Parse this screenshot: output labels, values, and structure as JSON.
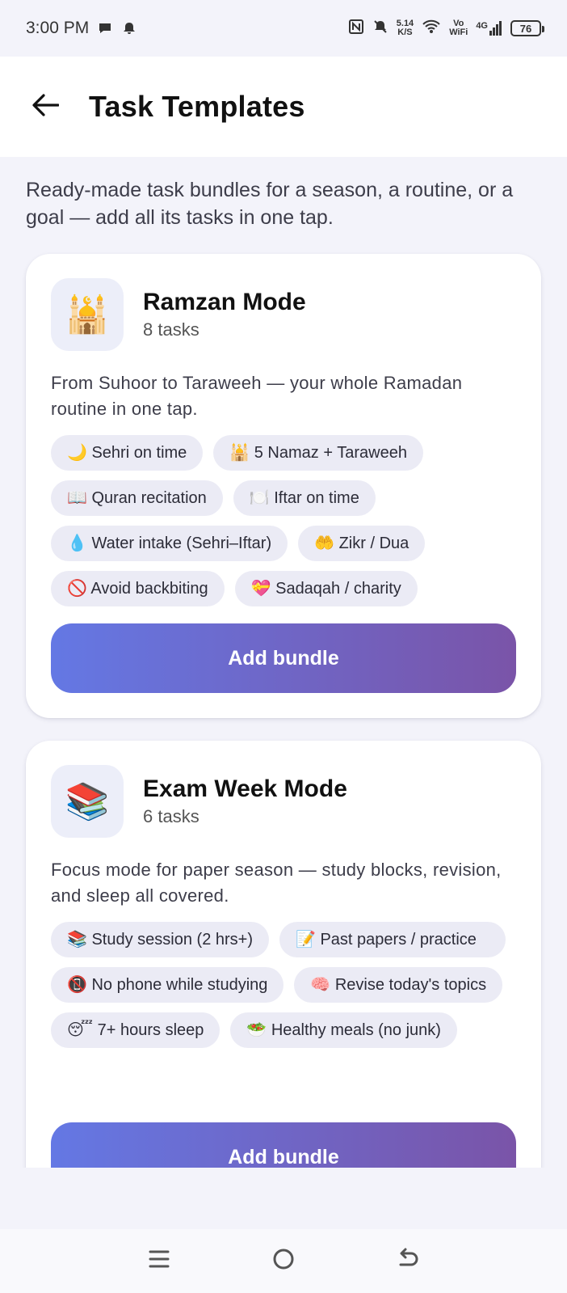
{
  "status_bar": {
    "time": "3:00 PM",
    "net_speed_value": "5.14",
    "net_speed_unit": "K/S",
    "volte_top": "Vo",
    "volte_bottom": "WiFi",
    "signal_label": "4G",
    "battery": "76"
  },
  "header": {
    "title": "Task Templates"
  },
  "intro": "Ready-made task bundles for a season, a routine, or a goal — add all its tasks in one tap.",
  "bundles": [
    {
      "icon": "🕌",
      "title": "Ramzan Mode",
      "count": "8 tasks",
      "description": "From Suhoor to Taraweeh — your whole Ramadan routine in one tap.",
      "chips": [
        "🌙 Sehri on time",
        "🕌 5 Namaz + Taraweeh",
        "📖 Quran recitation",
        "🍽️ Iftar on time",
        "💧 Water intake (Sehri–Iftar)",
        "🤲 Zikr / Dua",
        "🚫 Avoid backbiting",
        "💝 Sadaqah / charity"
      ],
      "button": "Add bundle"
    },
    {
      "icon": "📚",
      "title": "Exam Week Mode",
      "count": "6 tasks",
      "description": "Focus mode for paper season — study blocks, revision, and sleep all covered.",
      "chips": [
        "📚 Study session (2 hrs+)",
        "📝 Past papers / practice",
        "📵 No phone while studying",
        "🧠 Revise today's topics",
        "😴 7+ hours sleep",
        "🥗 Healthy meals (no junk)"
      ],
      "button": "Add bundle"
    }
  ],
  "icons": {
    "back": "arrow-left-icon",
    "menu": "menu-icon",
    "home": "home-circle-icon",
    "back_nav": "return-icon"
  }
}
